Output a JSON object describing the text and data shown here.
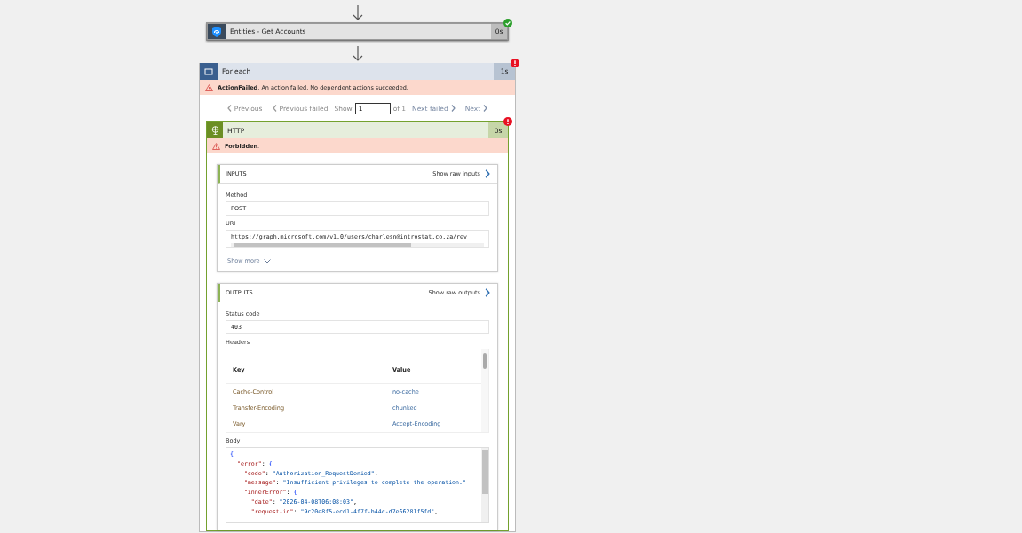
{
  "actions": [
    {
      "title": "Entities - Get Accounts",
      "duration": "0s",
      "failed": false
    }
  ],
  "foreach": {
    "title": "For each",
    "duration": "1s",
    "failed": true,
    "error": "**ActionFailed**. An action failed. No dependent actions succeeded.",
    "pager": {
      "previous": "Previous",
      "previous_failed": "Previous failed",
      "show_label": "Show",
      "index": "1",
      "of": "of 1",
      "next_failed": "Next failed",
      "next": "Next"
    },
    "http": {
      "title": "HTTP",
      "duration": "0s",
      "failed": true,
      "error": "**Forbidden**.",
      "inputs": {
        "title": "INPUTS",
        "raw_link": "Show raw inputs",
        "fields": [
          {
            "label": "Method",
            "value": "POST",
            "kind": "text"
          },
          {
            "label": "URI",
            "value": "https://graph.microsoft.com/v1.0/users/charlesn@introstat.co.za/rev",
            "kind": "scroll"
          }
        ],
        "show_more": "Show more"
      },
      "outputs": {
        "title": "OUTPUTS",
        "raw_link": "Show raw outputs",
        "status_label": "Status code",
        "status": "403",
        "headers_label": "Headers",
        "headers": {
          "columns": [
            "Key",
            "Value"
          ],
          "rows": [
            [
              "Cache-Control",
              "no-cache"
            ],
            [
              "Transfer-Encoding",
              "chunked"
            ],
            [
              "Vary",
              "Accept-Encoding"
            ]
          ]
        },
        "body_label": "Body",
        "body": [
          [
            {
              "kind": "brace",
              "text": "{"
            }
          ],
          [
            {
              "kind": "key",
              "text": "  \"error\""
            },
            {
              "kind": "punct",
              "text": ": "
            },
            {
              "kind": "brace",
              "text": "{"
            }
          ],
          [
            {
              "kind": "key",
              "text": "    \"code\""
            },
            {
              "kind": "punct",
              "text": ": "
            },
            {
              "kind": "string",
              "text": "\"Authorization_RequestDenied\""
            },
            {
              "kind": "punct",
              "text": ","
            }
          ],
          [
            {
              "kind": "key",
              "text": "    \"message\""
            },
            {
              "kind": "punct",
              "text": ": "
            },
            {
              "kind": "string",
              "text": "\"Insufficient privileges to complete the operation.\""
            }
          ],
          [
            {
              "kind": "key",
              "text": "    \"innerError\""
            },
            {
              "kind": "punct",
              "text": ": "
            },
            {
              "kind": "brace",
              "text": "{"
            }
          ],
          [
            {
              "kind": "key",
              "text": "      \"date\""
            },
            {
              "kind": "punct",
              "text": ": "
            },
            {
              "kind": "string",
              "text": "\"2026-04-08T06:08:03\""
            },
            {
              "kind": "punct",
              "text": ","
            }
          ],
          [
            {
              "kind": "key",
              "text": "      \"request-id\""
            },
            {
              "kind": "punct",
              "text": ": "
            },
            {
              "kind": "string",
              "text": "\"9c20e8f5-ecd1-4f7f-b44c-d7e66281f5fd\""
            },
            {
              "kind": "punct",
              "text": ","
            }
          ]
        ]
      }
    }
  }
}
